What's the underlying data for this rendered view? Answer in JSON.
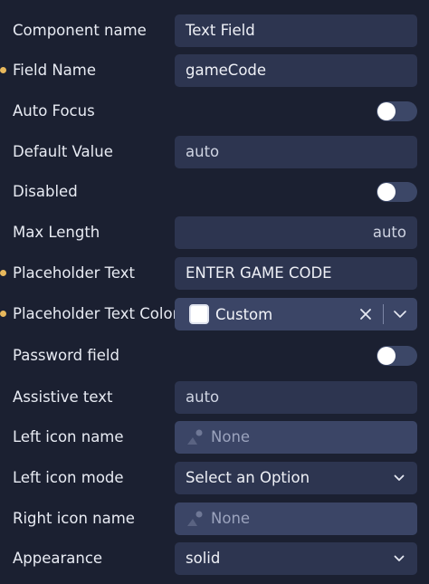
{
  "properties": [
    {
      "key": "component_name",
      "label": "Component name",
      "required": false,
      "type": "text",
      "value": "Text Field"
    },
    {
      "key": "field_name",
      "label": "Field Name",
      "required": true,
      "type": "text",
      "value": "gameCode"
    },
    {
      "key": "auto_focus",
      "label": "Auto Focus",
      "required": false,
      "type": "toggle",
      "value": "off"
    },
    {
      "key": "default_value",
      "label": "Default Value",
      "required": false,
      "type": "text",
      "value": "auto"
    },
    {
      "key": "disabled",
      "label": "Disabled",
      "required": false,
      "type": "toggle",
      "value": "off"
    },
    {
      "key": "max_length",
      "label": "Max Length",
      "required": false,
      "type": "number",
      "value": "auto"
    },
    {
      "key": "placeholder_text",
      "label": "Placeholder Text",
      "required": true,
      "type": "text",
      "value": "ENTER GAME CODE"
    },
    {
      "key": "placeholder_text_color",
      "label": "Placeholder Text Color",
      "required": true,
      "type": "color",
      "value": "Custom",
      "swatch_color": "#ffffff"
    },
    {
      "key": "password_field",
      "label": "Password field",
      "required": false,
      "type": "toggle",
      "value": "off"
    },
    {
      "key": "assistive_text",
      "label": "Assistive text",
      "required": false,
      "type": "text",
      "value": "auto"
    },
    {
      "key": "left_icon_name",
      "label": "Left icon name",
      "required": false,
      "type": "icon",
      "value": "None",
      "icon": "image-placeholder-icon"
    },
    {
      "key": "left_icon_mode",
      "label": "Left icon mode",
      "required": false,
      "type": "select",
      "value": "Select an Option"
    },
    {
      "key": "right_icon_name",
      "label": "Right icon name",
      "required": false,
      "type": "icon",
      "value": "None",
      "icon": "image-placeholder-icon"
    },
    {
      "key": "appearance",
      "label": "Appearance",
      "required": false,
      "type": "select",
      "value": "solid"
    }
  ],
  "colors": {
    "background": "#1b2031",
    "field": "#2d3550",
    "field_light": "#3b4566",
    "required_dot": "#e8b85c",
    "toggle_track": "#3c4767",
    "toggle_knob": "#ffffff"
  }
}
